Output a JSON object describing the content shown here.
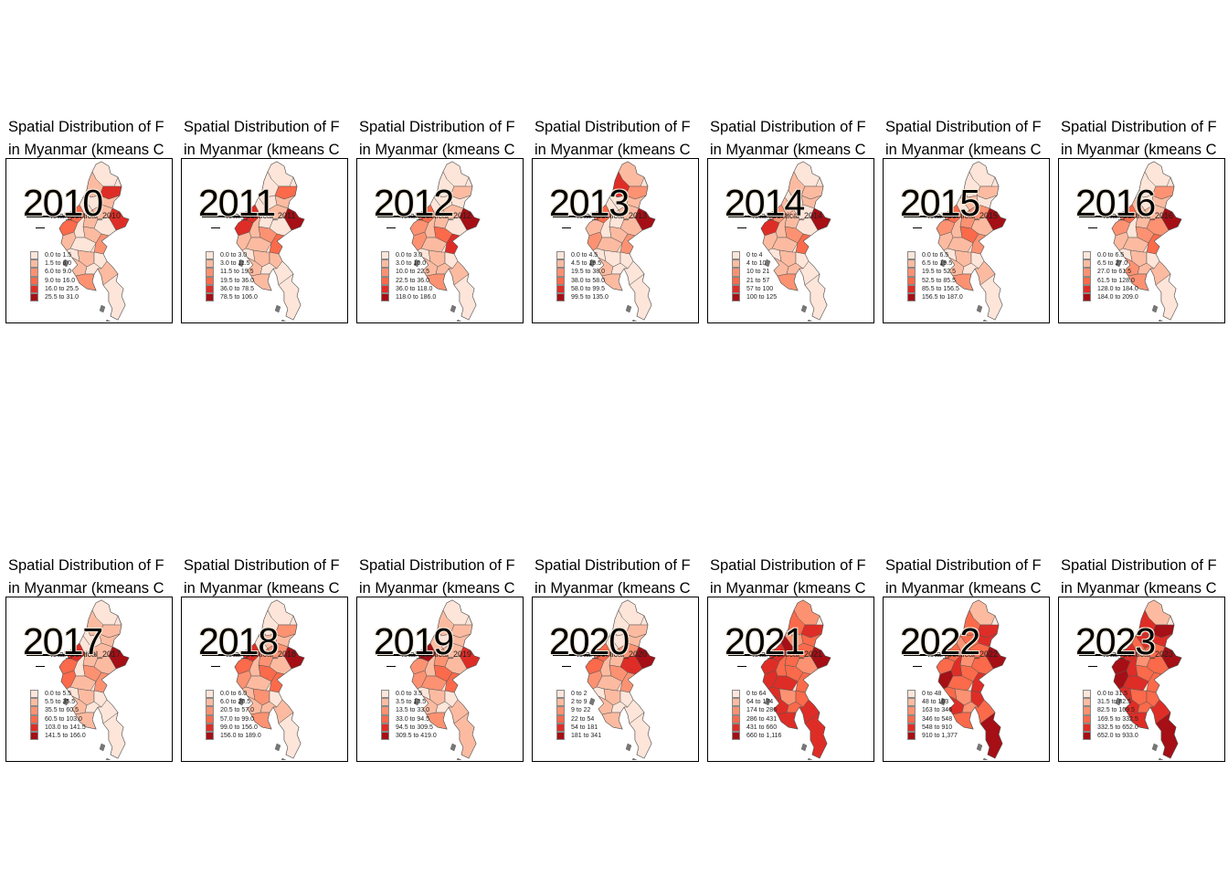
{
  "title_lines": [
    "Spatial Distribution of F",
    "in Myanmar (kmeans C"
  ],
  "legend_title": "total_political_",
  "palette": [
    "#fee5d9",
    "#fcbba1",
    "#fc9272",
    "#fb6a4a",
    "#de2d26",
    "#a50f15"
  ],
  "colors": {
    "region_stroke": "#555555",
    "frame": "#000000",
    "background": "#ffffff"
  },
  "panels": [
    {
      "year": "2010",
      "legend": [
        "0.0 to 1.5",
        "1.5 to 6.0",
        "6.0 to 9.0",
        "9.0 to 16.0",
        "16.0 to 25.5",
        "25.5 to 31.0"
      ]
    },
    {
      "year": "2011",
      "legend": [
        "0.0 to 3.0",
        "3.0 to 11.5",
        "11.5 to 19.5",
        "19.5 to 36.0",
        "36.0 to 78.5",
        "78.5 to 106.0"
      ]
    },
    {
      "year": "2012",
      "legend": [
        "0.0 to 3.0",
        "3.0 to 10.0",
        "10.0 to 22.5",
        "22.5 to 36.0",
        "36.0 to 118.0",
        "118.0 to 186.0"
      ]
    },
    {
      "year": "2013",
      "legend": [
        "0.0 to 4.5",
        "4.5 to 19.5",
        "19.5 to 38.0",
        "38.0 to 58.0",
        "58.0 to 99.5",
        "99.5 to 135.0"
      ]
    },
    {
      "year": "2014",
      "legend": [
        "0 to 4",
        "4 to 10",
        "10 to 21",
        "21 to 57",
        "57 to 100",
        "100 to 125"
      ]
    },
    {
      "year": "2015",
      "legend": [
        "0.0 to 6.5",
        "6.5 to 19.5",
        "19.5 to 52.5",
        "52.5 to 85.5",
        "85.5 to 156.5",
        "156.5 to 187.0"
      ]
    },
    {
      "year": "2016",
      "legend": [
        "0.0 to 6.5",
        "6.5 to 27.0",
        "27.0 to 61.5",
        "61.5 to 128.0",
        "128.0 to 184.0",
        "184.0 to 209.0"
      ]
    },
    {
      "year": "2017",
      "legend": [
        "0.0 to 5.5",
        "5.5 to 35.5",
        "35.5 to 60.5",
        "60.5 to 103.0",
        "103.0 to 141.5",
        "141.5 to 166.0"
      ]
    },
    {
      "year": "2018",
      "legend": [
        "0.0 to 6.0",
        "6.0 to 20.5",
        "20.5 to 57.0",
        "57.0 to 99.0",
        "99.0 to 156.0",
        "156.0 to 189.0"
      ]
    },
    {
      "year": "2019",
      "legend": [
        "0.0 to 3.5",
        "3.5 to 13.5",
        "13.5 to 33.0",
        "33.0 to 94.5",
        "94.5 to 309.5",
        "309.5 to 419.0"
      ]
    },
    {
      "year": "2020",
      "legend": [
        "0 to 2",
        "2 to 9",
        "9 to 22",
        "22 to 54",
        "54 to 181",
        "181 to 341"
      ]
    },
    {
      "year": "2021",
      "legend": [
        "0 to 64",
        "64 to 174",
        "174 to 286",
        "286 to 431",
        "431 to 660",
        "660 to 1,116"
      ]
    },
    {
      "year": "2022",
      "legend": [
        "0 to 48",
        "48 to 163",
        "163 to 346",
        "346 to 548",
        "548 to 910",
        "910 to 1,377"
      ]
    },
    {
      "year": "2023",
      "legend": [
        "0.0 to 31.5",
        "31.5 to 82.5",
        "82.5 to 169.5",
        "169.5 to 332.5",
        "332.5 to 652.0",
        "652.0 to 933.0"
      ]
    }
  ]
}
